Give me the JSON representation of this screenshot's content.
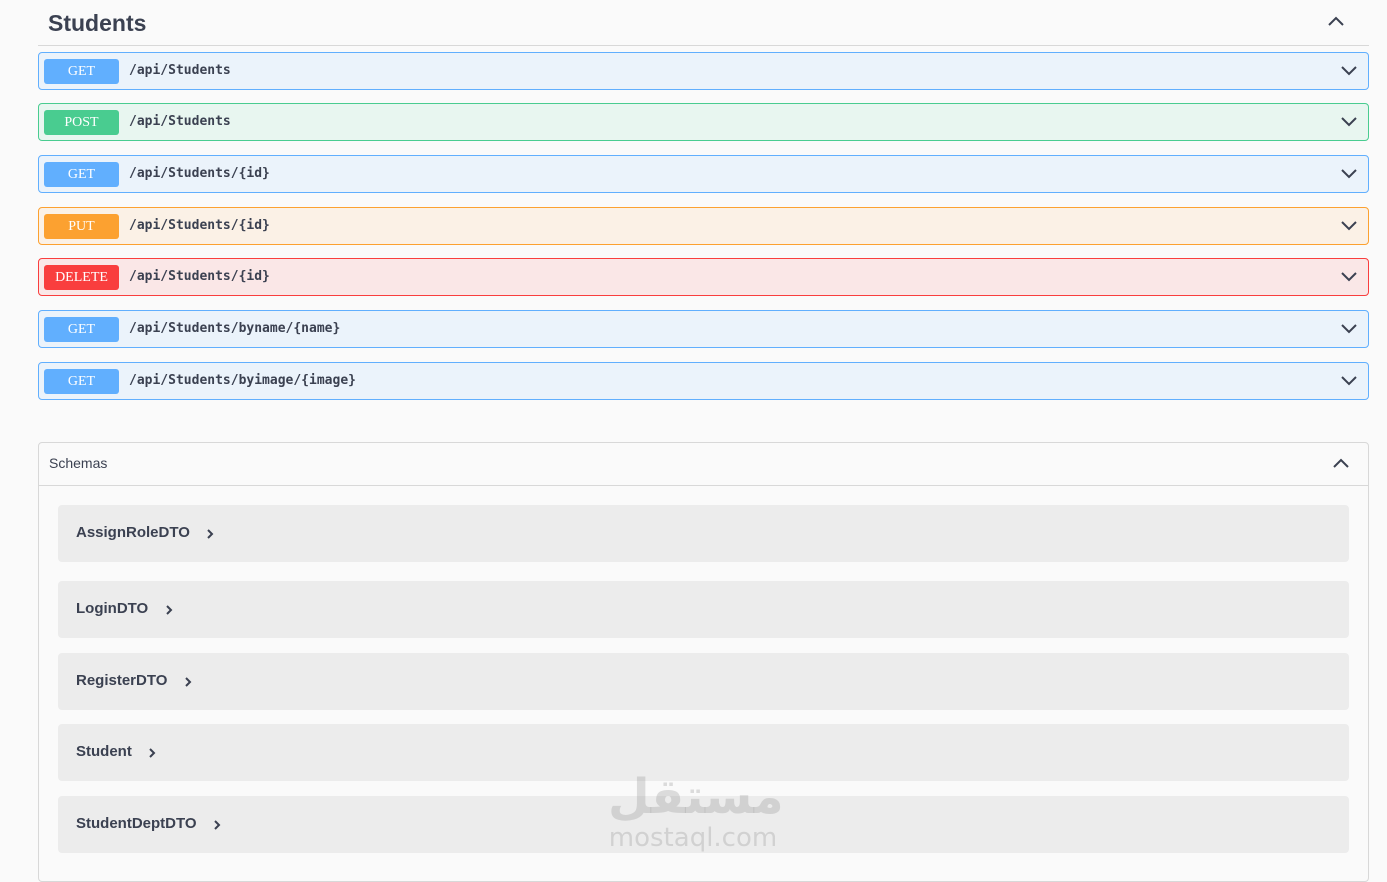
{
  "section": {
    "title": "Students"
  },
  "operations": [
    {
      "method": "GET",
      "path": "/api/Students"
    },
    {
      "method": "POST",
      "path": "/api/Students"
    },
    {
      "method": "GET",
      "path": "/api/Students/{id}"
    },
    {
      "method": "PUT",
      "path": "/api/Students/{id}"
    },
    {
      "method": "DELETE",
      "path": "/api/Students/{id}"
    },
    {
      "method": "GET",
      "path": "/api/Students/byname/{name}"
    },
    {
      "method": "GET",
      "path": "/api/Students/byimage/{image}"
    }
  ],
  "schemas": {
    "title": "Schemas",
    "models": [
      "AssignRoleDTO",
      "LoginDTO",
      "RegisterDTO",
      "Student",
      "StudentDeptDTO"
    ]
  },
  "watermark": {
    "arabic": "مستقل",
    "site": "mostaql.com"
  },
  "colors": {
    "get": "#61affe",
    "post": "#49cc90",
    "put": "#fca130",
    "delete": "#f93e3e"
  },
  "icons": {
    "collapse": "chevron-up-icon",
    "expand": "chevron-down-icon",
    "model": "chevron-right-icon"
  }
}
